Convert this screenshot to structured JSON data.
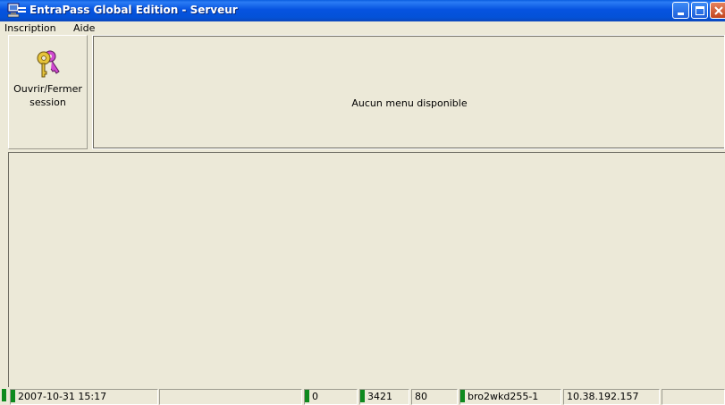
{
  "window": {
    "title": "EntraPass Global Edition - Serveur",
    "icon": "entrapass-app-icon",
    "controls": {
      "minimize": "minimize-icon",
      "maximize": "maximize-icon",
      "close": "close-icon"
    }
  },
  "menubar": {
    "items": [
      {
        "label": "Inscription"
      },
      {
        "label": "Aide"
      }
    ]
  },
  "toolbar": {
    "session_button": {
      "icon": "keys-icon",
      "label_line1": "Ouvrir/Fermer",
      "label_line2": "session"
    },
    "menu_panel_text": "Aucun menu disponible"
  },
  "statusbar": {
    "datetime": "2007-10-31 15:17",
    "empty1": "",
    "count1": "0",
    "port1": "3421",
    "port2": "80",
    "hostname": "bro2wkd255-1",
    "ip": "10.38.192.157",
    "empty2": ""
  },
  "colors": {
    "titlebar_blue": "#0653e0",
    "indicator_green": "#0e8a1e",
    "face": "#ece9d8"
  }
}
